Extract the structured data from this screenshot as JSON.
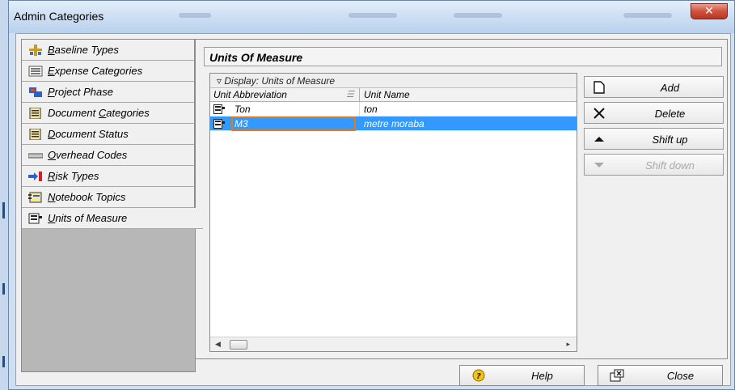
{
  "window": {
    "title": "Admin Categories"
  },
  "nav": {
    "items": [
      {
        "pre": "",
        "u": "B",
        "post": "aseline Types",
        "icon": "baseline-types-icon"
      },
      {
        "pre": "",
        "u": "E",
        "post": "xpense Categories",
        "icon": "expense-categories-icon"
      },
      {
        "pre": "",
        "u": "P",
        "post": "roject Phase",
        "icon": "project-phase-icon"
      },
      {
        "pre": "Document ",
        "u": "C",
        "post": "ategories",
        "icon": "document-categories-icon"
      },
      {
        "pre": "",
        "u": "D",
        "post": "ocument Status",
        "icon": "document-status-icon"
      },
      {
        "pre": "",
        "u": "O",
        "post": "verhead Codes",
        "icon": "overhead-codes-icon"
      },
      {
        "pre": "",
        "u": "R",
        "post": "isk Types",
        "icon": "risk-types-icon"
      },
      {
        "pre": "",
        "u": "N",
        "post": "otebook Topics",
        "icon": "notebook-topics-icon"
      },
      {
        "pre": "",
        "u": "U",
        "post": "nits of Measure",
        "icon": "units-of-measure-icon"
      }
    ]
  },
  "panel": {
    "title": "Units Of Measure",
    "display_label": "Display: Units of Measure",
    "columns": [
      "Unit Abbreviation",
      "Unit Name"
    ],
    "rows": [
      {
        "abbr": "Ton",
        "name": "ton"
      },
      {
        "abbr": "M3",
        "name": "metre moraba"
      }
    ]
  },
  "actions": {
    "add": "Add",
    "delete": "Delete",
    "shift_up": "Shift up",
    "shift_down": "Shift down"
  },
  "footer": {
    "help": "Help",
    "close": "Close"
  },
  "colors": {
    "selection": "#3399ff",
    "edit_border": "#e07a1a",
    "title_close": "#c8432e"
  }
}
